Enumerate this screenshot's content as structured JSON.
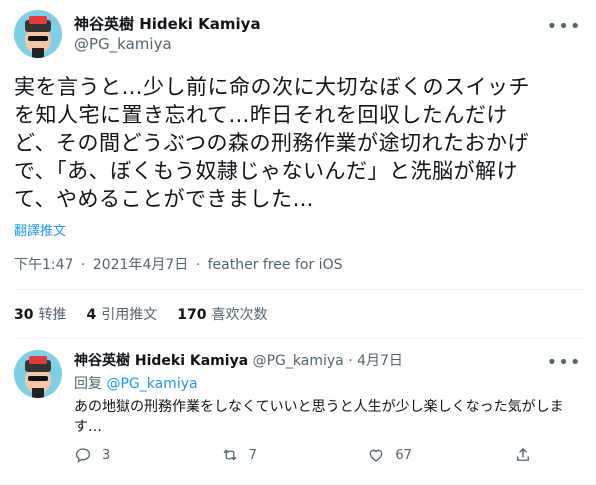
{
  "main_tweet": {
    "display_name": "神谷英樹 Hideki Kamiya",
    "handle": "@PG_kamiya",
    "text_lines": [
      "実を言うと…少し前に命の次に大切なぼくのスイッチ",
      "を知人宅に置き忘れて…昨日それを回収したんだけ",
      "ど、その間どうぶつの森の刑務作業が途切れたおかげ",
      "で、「あ、ぼくもう奴隷じゃないんだ」と洗脳が解け",
      "て、やめることができました…"
    ],
    "translate_label": "翻譯推文",
    "time": "下午1:47",
    "date": "2021年4月7日",
    "source": "feather free for iOS",
    "separator": "·"
  },
  "stats": [
    {
      "count": "30",
      "label": "转推"
    },
    {
      "count": "4",
      "label": "引用推文"
    },
    {
      "count": "170",
      "label": "喜欢次数"
    }
  ],
  "reply": {
    "display_name": "神谷英樹 Hideki Kamiya",
    "handle": "@PG_kamiya",
    "separator": "·",
    "date": "4月7日",
    "replying_prefix": "回复",
    "replying_to": "@PG_kamiya",
    "text": "あの地獄の刑務作業をしなくていいと思うと人生が少し楽しくなった気がします…",
    "actions": {
      "reply_count": "3",
      "retweet_count": "7",
      "like_count": "67"
    }
  },
  "icons": [
    "more-icon",
    "reply-icon",
    "retweet-icon",
    "like-icon",
    "share-icon"
  ],
  "colors": {
    "link": "#1d9bf0",
    "muted": "#536471",
    "text": "#0f1419"
  }
}
